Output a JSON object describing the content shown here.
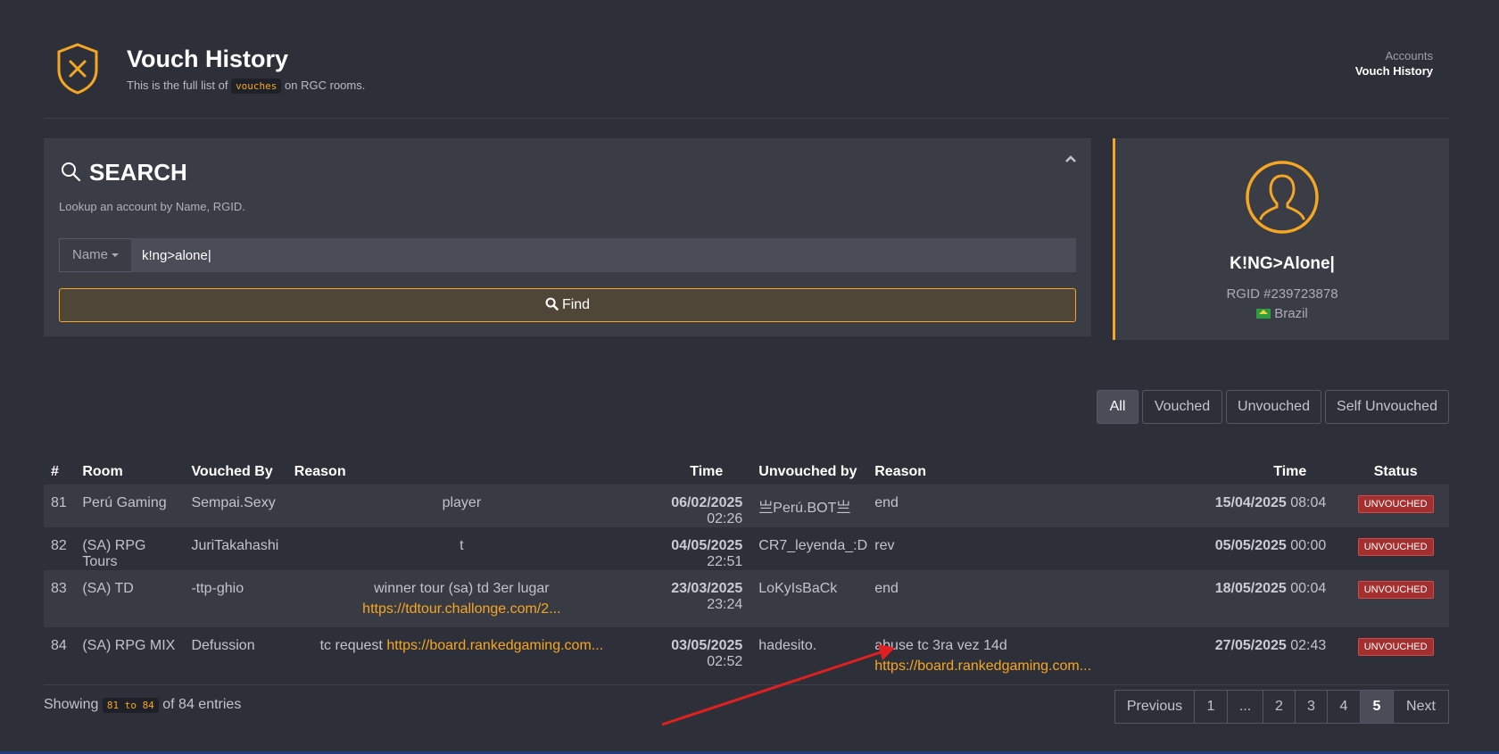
{
  "header": {
    "title": "Vouch History",
    "subtitle_pre": "This is the full list of",
    "subtitle_code": "vouches",
    "subtitle_post": "on RGC rooms.",
    "breadcrumb_parent": "Accounts",
    "breadcrumb_current": "Vouch History"
  },
  "search": {
    "title": "SEARCH",
    "description": "Lookup an account by Name, RGID.",
    "dropdown_label": "Name",
    "input_value": "k!ng>alone|",
    "find_label": "Find"
  },
  "profile": {
    "name": "K!NG>Alone|",
    "rgid": "RGID #239723878",
    "country": "Brazil"
  },
  "filters": [
    "All",
    "Vouched",
    "Unvouched",
    "Self Unvouched"
  ],
  "table": {
    "headers": [
      "#",
      "Room",
      "Vouched By",
      "Reason",
      "Time",
      "Unvouched by",
      "Reason",
      "Time",
      "Status"
    ],
    "rows": [
      {
        "num": "81",
        "room": "Perú Gaming",
        "vouched_by": "Sempai.Sexy",
        "reason_text": "player",
        "reason_link": "",
        "time_date": "06/02/2025",
        "time_clock": "02:26",
        "unvouched_by": "亗Perú.BOT亗",
        "unreason_text": "end",
        "unreason_link": "",
        "untime_date": "15/04/2025",
        "untime_clock": "08:04",
        "status": "UNVOUCHED"
      },
      {
        "num": "82",
        "room": "(SA) RPG Tours",
        "vouched_by": "JuriTakahashi",
        "reason_text": "t",
        "reason_link": "",
        "time_date": "04/05/2025",
        "time_clock": "22:51",
        "unvouched_by": "CR7_leyenda_:D",
        "unreason_text": "rev",
        "unreason_link": "",
        "untime_date": "05/05/2025",
        "untime_clock": "00:00",
        "status": "UNVOUCHED"
      },
      {
        "num": "83",
        "room": "(SA) TD",
        "vouched_by": "-ttp-ghio",
        "reason_text": "winner tour (sa) td 3er lugar",
        "reason_link": "https://tdtour.challonge.com/2...",
        "time_date": "23/03/2025",
        "time_clock": "23:24",
        "unvouched_by": "LoKyIsBaCk",
        "unreason_text": "end",
        "unreason_link": "",
        "untime_date": "18/05/2025",
        "untime_clock": "00:04",
        "status": "UNVOUCHED"
      },
      {
        "num": "84",
        "room": "(SA) RPG MIX",
        "vouched_by": "Defussion",
        "reason_text": "tc request",
        "reason_link": "https://board.rankedgaming.com...",
        "time_date": "03/05/2025",
        "time_clock": "02:52",
        "unvouched_by": "hadesito.",
        "unreason_text": "abuse tc 3ra vez 14d",
        "unreason_link": "https://board.rankedgaming.com...",
        "untime_date": "27/05/2025",
        "untime_clock": "02:43",
        "status": "UNVOUCHED"
      }
    ]
  },
  "footer": {
    "showing_pre": "Showing",
    "showing_range": "81 to 84",
    "showing_post": "of 84 entries"
  },
  "pagination": [
    "Previous",
    "1",
    "...",
    "2",
    "3",
    "4",
    "5",
    "Next"
  ],
  "colors": {
    "accent": "#f5a623",
    "background": "#2e3039",
    "panel": "#3a3c46",
    "badge": "#a32f2f",
    "annotation_arrow": "#e02020"
  }
}
